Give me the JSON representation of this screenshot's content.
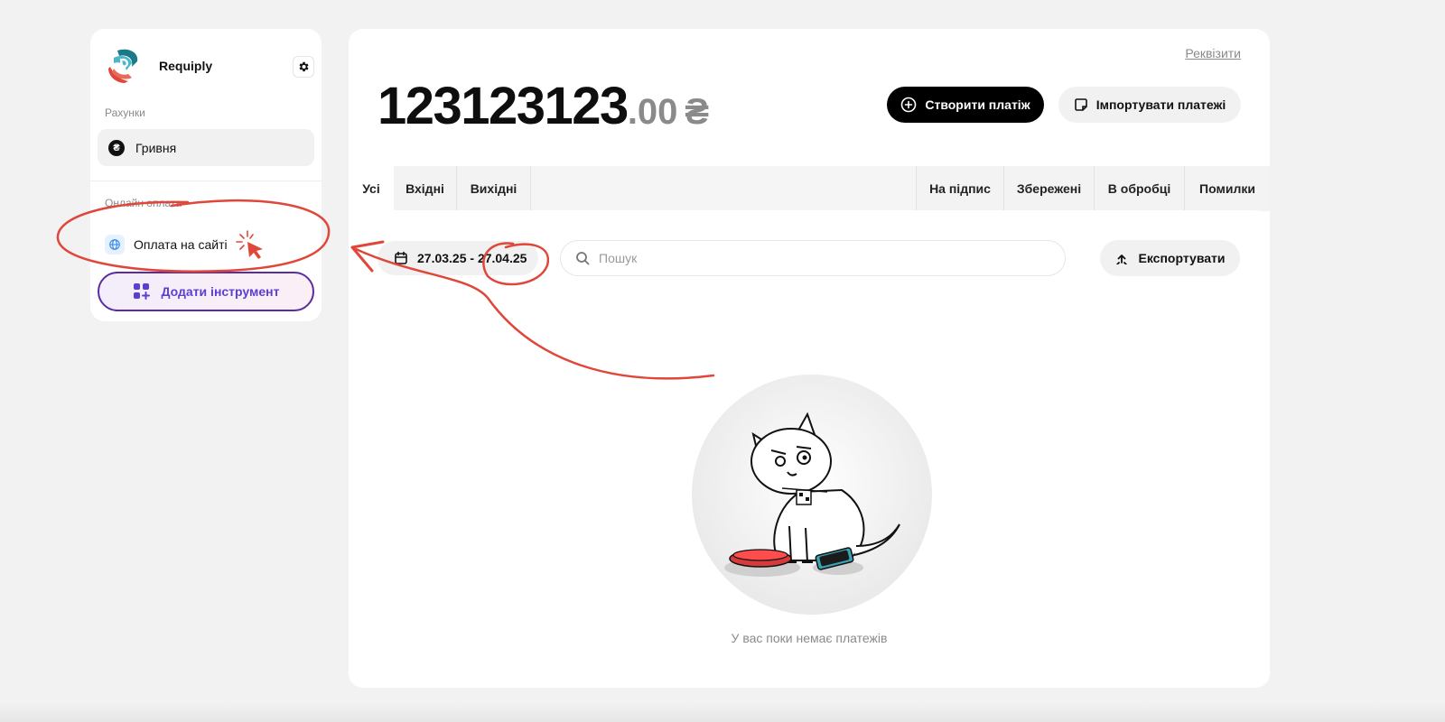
{
  "sidebar": {
    "brand_name": "Requiply",
    "accounts_label": "Рахунки",
    "accounts": [
      {
        "label": "Гривня",
        "icon": "hryvnia-icon"
      }
    ],
    "online_payment_label": "Онлайн оплата",
    "online_items": [
      {
        "label": "Оплата на сайті",
        "icon": "globe-icon"
      }
    ],
    "add_tool_label": "Додати інструмент"
  },
  "header": {
    "requisites_link": "Реквізити",
    "balance_integer": "123123123",
    "balance_fraction": ".00",
    "currency": "₴",
    "create_payment_label": "Створити платіж",
    "import_payments_label": "Імпортувати платежі"
  },
  "tabs_left": [
    "Усі",
    "Вхідні",
    "Вихідні"
  ],
  "tabs_right": [
    "На підпис",
    "Збережені",
    "В обробці",
    "Помилки"
  ],
  "active_tab": "Усі",
  "filters": {
    "date_range": "27.03.25 - 27.04.25",
    "search_placeholder": "Пошук",
    "export_label": "Експортувати"
  },
  "empty_state": {
    "message": "У вас поки немає платежів"
  },
  "colors": {
    "accent": "#000000",
    "add_tool_border": "#5b2ca0",
    "annotation": "#e0473a"
  }
}
